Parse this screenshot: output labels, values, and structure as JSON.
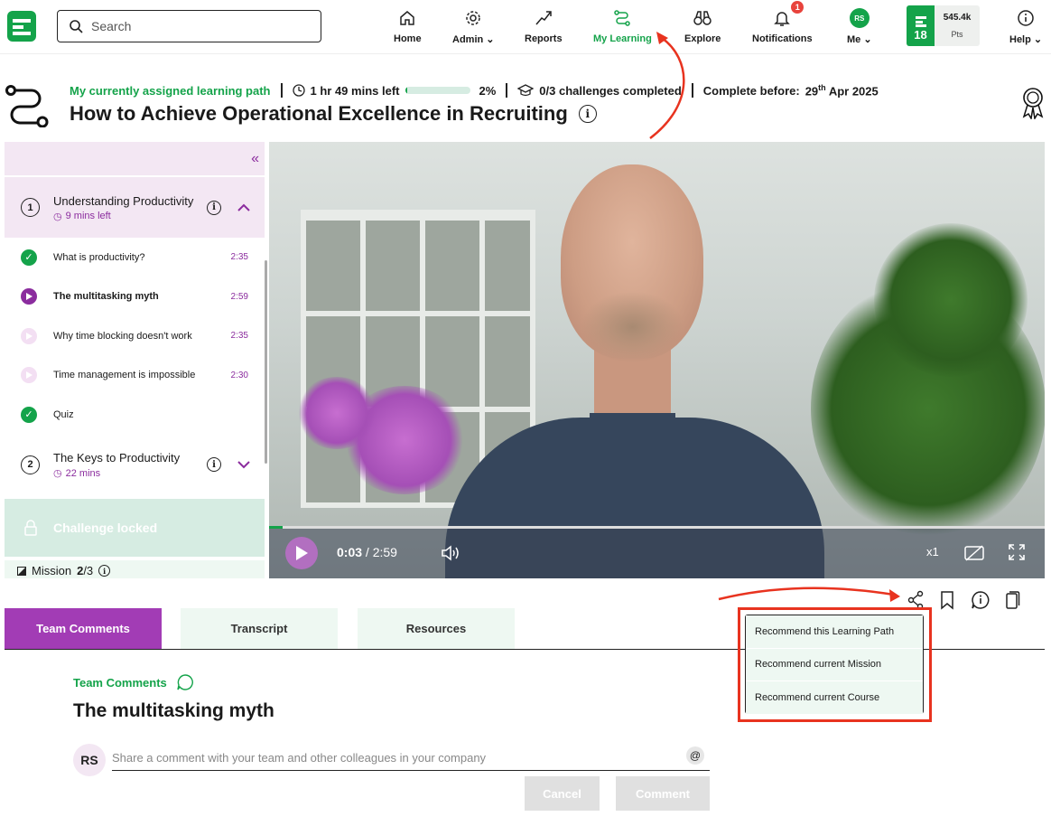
{
  "nav": {
    "search_placeholder": "Search",
    "items": [
      {
        "label": "Home",
        "icon": "home-icon"
      },
      {
        "label": "Admin",
        "icon": "gear-icon"
      },
      {
        "label": "Reports",
        "icon": "trend-icon"
      },
      {
        "label": "My Learning",
        "icon": "path-icon",
        "active": true
      },
      {
        "label": "Explore",
        "icon": "binoculars-icon"
      },
      {
        "label": "Notifications",
        "icon": "bell-icon",
        "badge": "1"
      },
      {
        "label": "Me",
        "icon": "avatar",
        "initials": "RS"
      },
      {
        "label": "Help",
        "icon": "info-icon"
      }
    ],
    "level": "18",
    "points": "545.4k",
    "points_label": "Pts"
  },
  "header": {
    "assigned_label": "My currently assigned learning path",
    "time_left": "1 hr 49 mins left",
    "progress_percent": 2,
    "progress_label": "2%",
    "challenges": "0/3 challenges completed",
    "complete_before_label": "Complete before:",
    "complete_before_day": "29",
    "complete_before_suffix": "th",
    "complete_before_rest": "Apr 2025",
    "title": "How to Achieve Operational Excellence in Recruiting"
  },
  "sidebar": {
    "modules": [
      {
        "number": "1",
        "name": "Understanding Productivity",
        "time_left": "9 mins left",
        "lessons": [
          {
            "name": "What is productivity?",
            "duration": "2:35",
            "status": "done"
          },
          {
            "name": "The multitasking myth",
            "duration": "2:59",
            "status": "current"
          },
          {
            "name": "Why time blocking doesn't work",
            "duration": "2:35",
            "status": "todo"
          },
          {
            "name": "Time management is impossible",
            "duration": "2:30",
            "status": "todo"
          },
          {
            "name": "Quiz",
            "duration": "",
            "status": "done"
          }
        ]
      },
      {
        "number": "2",
        "name": "The Keys to Productivity",
        "time_left": "22 mins"
      }
    ],
    "challenge_locked": "Challenge locked",
    "mission_label": "Mission",
    "mission_current": "2",
    "mission_total": "/3"
  },
  "video": {
    "current_time": "0:03",
    "duration": "/ 2:59",
    "progress_fraction": 0.017,
    "speed": "x1"
  },
  "tabs": [
    {
      "label": "Team Comments",
      "active": true
    },
    {
      "label": "Transcript"
    },
    {
      "label": "Resources"
    }
  ],
  "share_menu": [
    "Recommend this Learning Path",
    "Recommend current Mission",
    "Recommend current Course"
  ],
  "comments": {
    "section_label": "Team Comments",
    "lesson_title": "The multitasking myth",
    "avatar_initials": "RS",
    "placeholder": "Share a comment with your team and other colleagues in your company",
    "at_symbol": "@",
    "cancel_label": "Cancel",
    "comment_label": "Comment"
  },
  "colors": {
    "brand_green": "#14a34a",
    "accent_purple": "#a23cb5",
    "annotation_red": "#e8331f"
  }
}
